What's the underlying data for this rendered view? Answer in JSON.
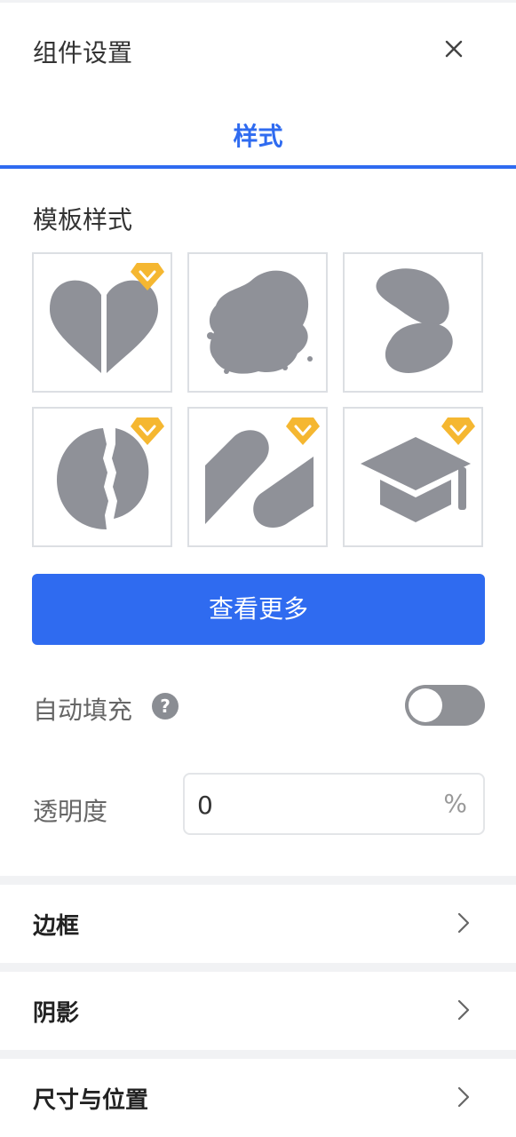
{
  "header": {
    "title": "组件设置",
    "close_icon": "close-icon"
  },
  "tabs": [
    {
      "label": "样式",
      "active": true
    }
  ],
  "template": {
    "label": "模板样式",
    "items": [
      {
        "shape": "split-heart",
        "premium": true
      },
      {
        "shape": "ink-blot",
        "premium": false
      },
      {
        "shape": "two-blobs",
        "premium": false
      },
      {
        "shape": "torn-circle",
        "premium": true
      },
      {
        "shape": "slanted-capsules",
        "premium": true
      },
      {
        "shape": "graduation-cap",
        "premium": true
      }
    ],
    "more_button": "查看更多"
  },
  "auto_fill": {
    "label": "自动填充",
    "help": "?",
    "enabled": false
  },
  "opacity": {
    "label": "透明度",
    "value": "0",
    "unit": "%"
  },
  "sections": [
    {
      "label": "边框"
    },
    {
      "label": "阴影"
    },
    {
      "label": "尺寸与位置"
    }
  ],
  "colors": {
    "accent": "#2f6bf0",
    "shape": "#8f9198",
    "badge": "#f5b731"
  }
}
